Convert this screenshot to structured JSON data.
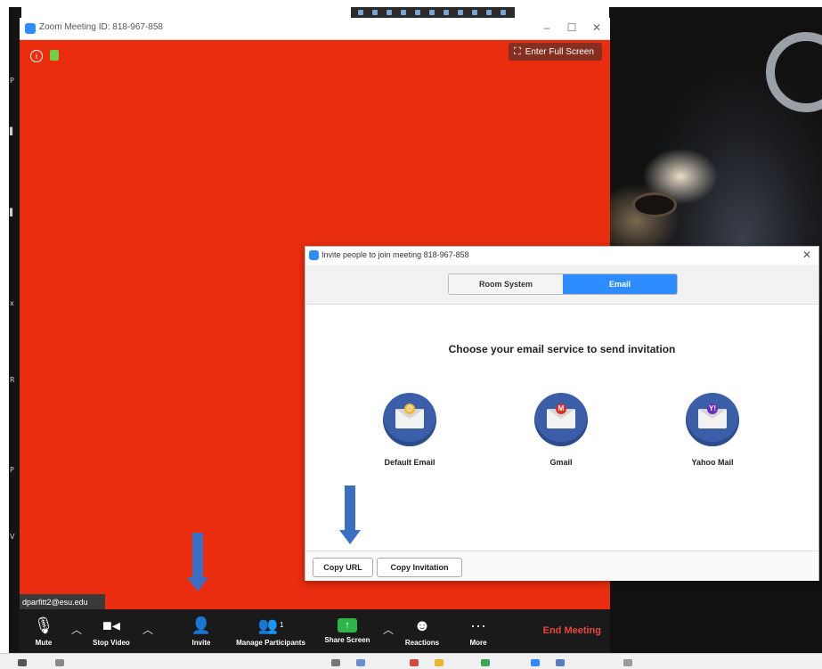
{
  "zoom_window": {
    "title": "Zoom Meeting ID: 818-967-858",
    "fullscreen_label": "Enter Full Screen",
    "participant_tag": "dparfitt2@esu.edu"
  },
  "toolbar": {
    "mute_label": "Mute",
    "stop_video_label": "Stop Video",
    "invite_label": "Invite",
    "manage_participants_label": "Manage Participants",
    "participant_count": "1",
    "share_screen_label": "Share Screen",
    "reactions_label": "Reactions",
    "more_label": "More",
    "end_meeting_label": "End Meeting"
  },
  "invite_dialog": {
    "title": "Invite people to join meeting 818-967-858",
    "tabs": [
      {
        "label": "Room System",
        "active": false
      },
      {
        "label": "Email",
        "active": true
      }
    ],
    "heading": "Choose your email service to send invitation",
    "services": [
      {
        "label": "Default Email",
        "icon": "default-email-icon"
      },
      {
        "label": "Gmail",
        "icon": "gmail-icon"
      },
      {
        "label": "Yahoo Mail",
        "icon": "yahoo-mail-icon"
      }
    ],
    "copy_url_label": "Copy URL",
    "copy_invitation_label": "Copy Invitation"
  },
  "colors": {
    "video_background": "#ea2d0f",
    "accent_blue": "#2d8cff",
    "end_meeting_red": "#e8453c",
    "share_green": "#2db548",
    "annotation_arrow": "#3a6fc4"
  }
}
